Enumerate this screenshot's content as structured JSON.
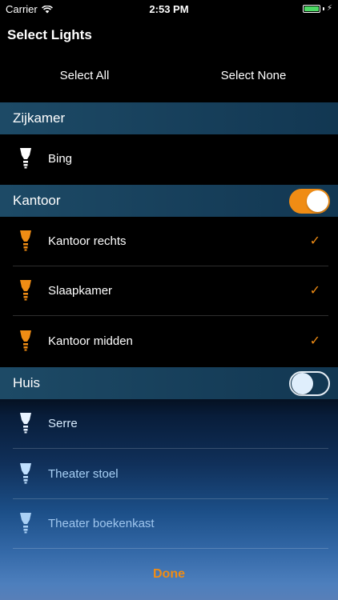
{
  "status_bar": {
    "carrier": "Carrier",
    "time": "2:53 PM"
  },
  "page_title": "Select Lights",
  "select_all_label": "Select All",
  "select_none_label": "Select None",
  "sections": [
    {
      "title": "Zijkamer",
      "lights": [
        {
          "name": "Bing",
          "checked": false
        }
      ]
    },
    {
      "title": "Kantoor",
      "toggle_on": true,
      "lights": [
        {
          "name": "Kantoor rechts",
          "checked": true
        },
        {
          "name": "Slaapkamer",
          "checked": true
        },
        {
          "name": "Kantoor midden",
          "checked": true
        }
      ]
    },
    {
      "title": "Huis",
      "toggle_on": false,
      "lights": [
        {
          "name": "Serre",
          "checked": false
        },
        {
          "name": "Theater stoel",
          "checked": false
        },
        {
          "name": "Theater boekenkast",
          "checked": false
        }
      ]
    }
  ],
  "checkmark_glyph": "✓",
  "done_label": "Done",
  "colors": {
    "accent": "#f08c14",
    "bulb_white": "#ffffff",
    "bulb_blue": "#bfe0ff",
    "text_blue": "#a8d0f5"
  }
}
